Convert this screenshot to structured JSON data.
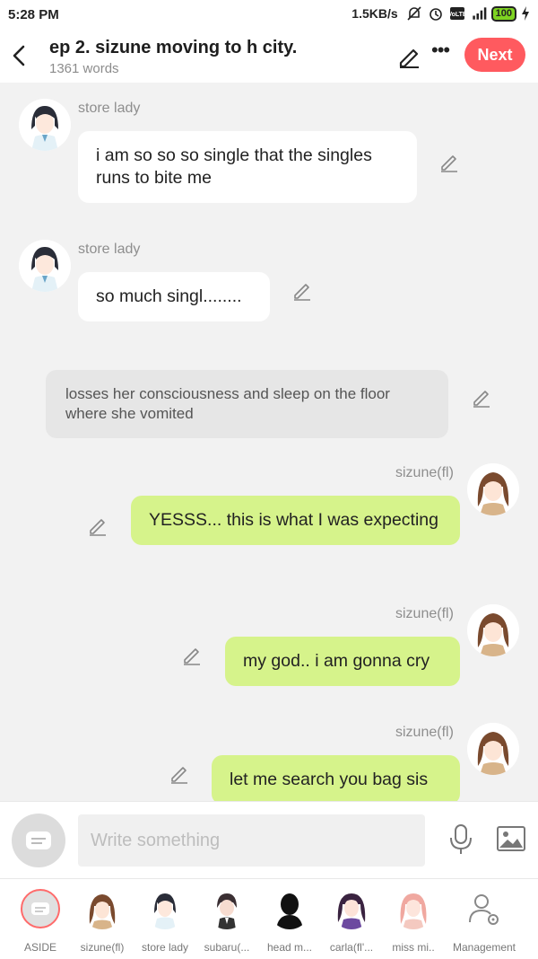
{
  "status_bar": {
    "time": "5:28 PM",
    "speed": "1.5KB/s",
    "battery": "100"
  },
  "header": {
    "title": "ep 2. sizune moving to h city.",
    "word_count": "1361 words",
    "next_label": "Next"
  },
  "messages": [
    {
      "type": "left",
      "speaker": "store lady",
      "text": "i am so so so single that the singles runs to bite me"
    },
    {
      "type": "left",
      "speaker": "store lady",
      "text": "so much singl........"
    },
    {
      "type": "aside",
      "text": "losses her consciousness and sleep on the floor where she vomited"
    },
    {
      "type": "right",
      "speaker": "sizune(fl)",
      "text": "YESSS... this is what I was expecting"
    },
    {
      "type": "right",
      "speaker": "sizune(fl)",
      "text": "my god.. i am gonna cry"
    },
    {
      "type": "right",
      "speaker": "sizune(fl)",
      "text": "let me search you bag sis"
    }
  ],
  "composer": {
    "placeholder": "Write something"
  },
  "characters": [
    {
      "label": "ASIDE",
      "icon": "aside-icon"
    },
    {
      "label": "sizune(fl)",
      "icon": "sizune-avatar"
    },
    {
      "label": "store lady",
      "icon": "store-lady-avatar"
    },
    {
      "label": "subaru(...",
      "icon": "subaru-avatar"
    },
    {
      "label": "head m...",
      "icon": "silhouette-avatar"
    },
    {
      "label": "carla(fl'...",
      "icon": "carla-avatar"
    },
    {
      "label": "miss mi..",
      "icon": "miss-mi-avatar"
    },
    {
      "label": "Management",
      "icon": "management-icon"
    }
  ],
  "colors": {
    "accent": "#ff5a5f",
    "right_bubble": "#d6f38b",
    "left_bubble": "#ffffff",
    "aside_bubble": "#e6e6e6"
  }
}
